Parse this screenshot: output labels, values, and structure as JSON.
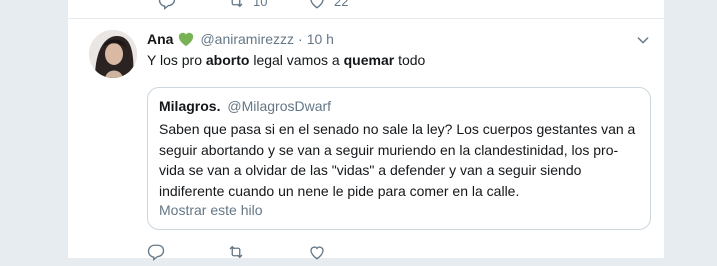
{
  "previous_tweet": {
    "retweet_count": "10",
    "like_count": "22"
  },
  "tweet": {
    "author_name": "Ana",
    "author_emoji": "green-heart",
    "username": "@aniramirezzz",
    "separator": "·",
    "time": "10 h",
    "text_parts": [
      "Y los pro ",
      "aborto",
      " legal vamos a ",
      "quemar",
      " todo"
    ],
    "quote": {
      "author_name": "Milagros.",
      "username": "@MilagrosDwarf",
      "lines": [
        "Saben que pasa si en el senado no sale la ley? Los cuerpos gestantes van a",
        "seguir abortando y se van a seguir muriendo en la clandestinidad, los pro-",
        "vida se van a olvidar de las \"vidas\" a defender y van a seguir siendo",
        "indiferente cuando un nene le pide para comer en la calle."
      ],
      "show_thread": "Mostrar este hilo"
    }
  },
  "colors": {
    "background": "#e6ecf0",
    "card": "#ffffff",
    "muted": "#657786",
    "heart_green": "#77b255",
    "border": "#ccd6dd"
  }
}
